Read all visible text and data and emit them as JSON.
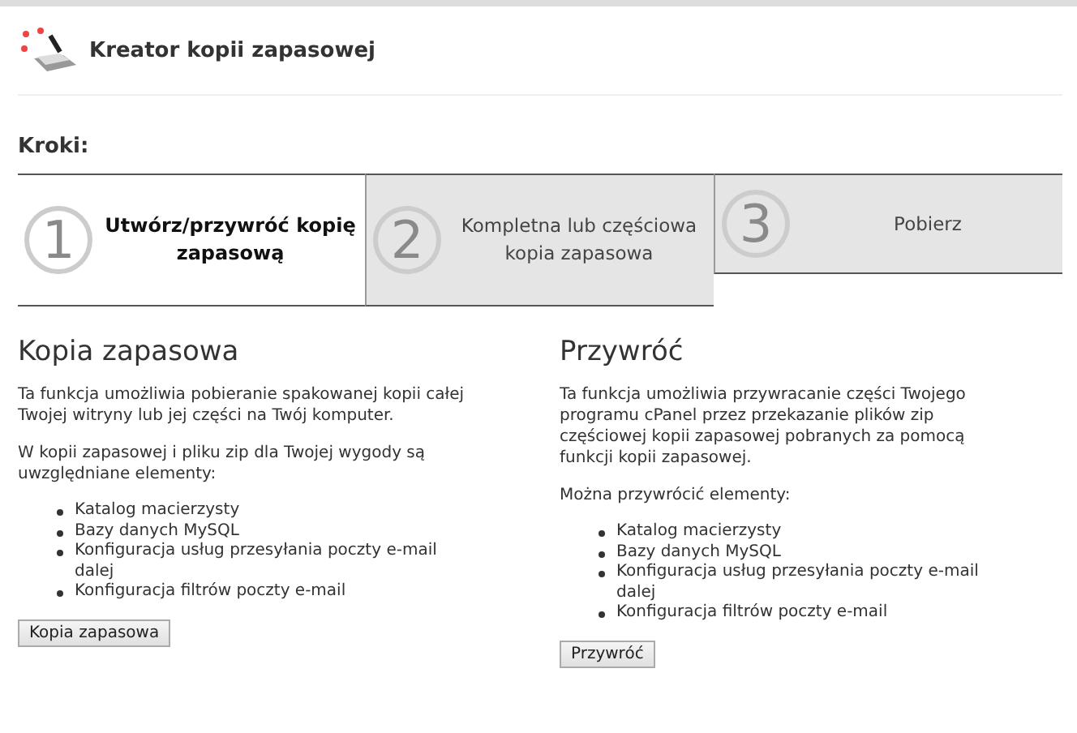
{
  "title": "Kreator kopii zapasowej",
  "steps_label": "Kroki:",
  "steps": [
    {
      "number": "1",
      "label": "Utwórz/przywróć kopię zapasową",
      "selected": true
    },
    {
      "number": "2",
      "label": "Kompletna lub częściowa kopia zapasowa",
      "selected": false
    },
    {
      "number": "3",
      "label": "Pobierz",
      "selected": false
    }
  ],
  "sections": [
    {
      "heading": "Kopia zapasowa",
      "paragraphs": [
        "Ta funkcja umożliwia pobieranie spakowanej kopii całej Twojej witryny lub jej części na Twój komputer.",
        "W kopii zapasowej i pliku zip dla Twojej wygody są uwzględniane elementy:"
      ],
      "items": [
        "Katalog macierzysty",
        "Bazy danych MySQL",
        "Konfiguracja usług przesyłania poczty e-mail dalej",
        "Konfiguracja filtrów poczty e-mail"
      ],
      "button": "Kopia zapasowa"
    },
    {
      "heading": "Przywróć",
      "paragraphs": [
        "Ta funkcja umożliwia przywracanie części Twojego programu cPanel przez przekazanie plików zip częściowej kopii zapasowej pobranych za pomocą funkcji kopii zapasowej.",
        "Można przywrócić elementy:"
      ],
      "items": [
        "Katalog macierzysty",
        "Bazy danych MySQL",
        "Konfiguracja usług przesyłania poczty e-mail dalej",
        "Konfiguracja filtrów poczty e-mail"
      ],
      "button": "Przywróć"
    }
  ]
}
